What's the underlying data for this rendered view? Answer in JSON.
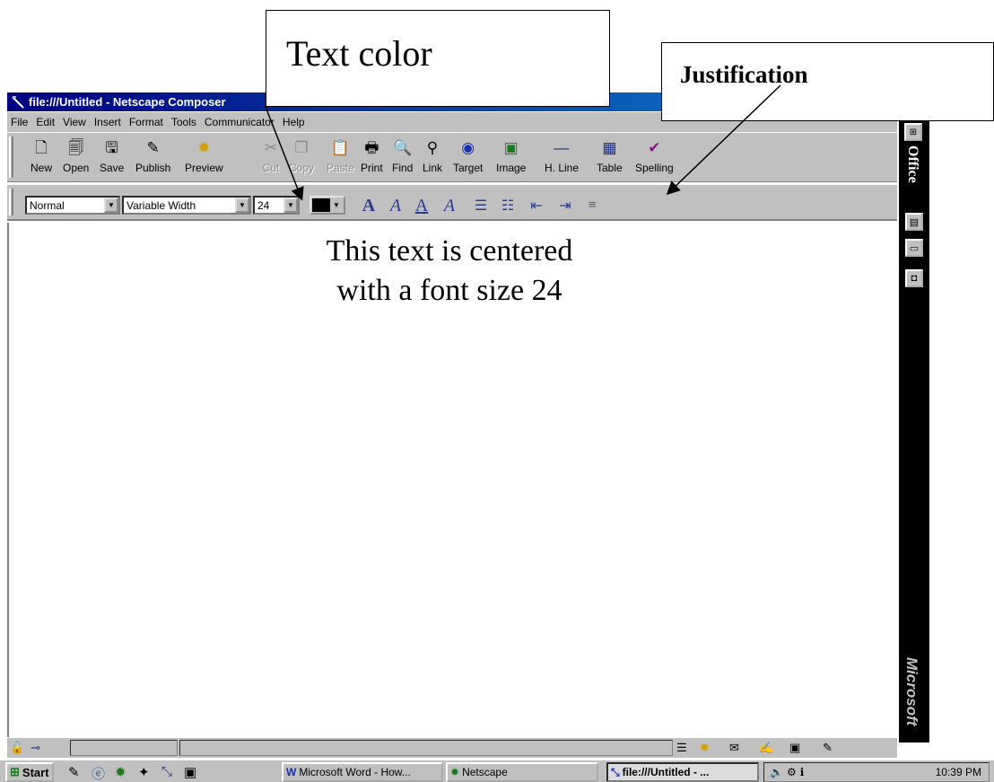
{
  "window": {
    "title": "file:///Untitled - Netscape Composer"
  },
  "menu": [
    "File",
    "Edit",
    "View",
    "Insert",
    "Format",
    "Tools",
    "Communicator",
    "Help"
  ],
  "toolbar": {
    "buttons": [
      {
        "label": "New",
        "icon": "new-page-icon"
      },
      {
        "label": "Open",
        "icon": "open-icon"
      },
      {
        "label": "Save",
        "icon": "save-disk-icon"
      },
      {
        "label": "Publish",
        "icon": "publish-icon"
      },
      {
        "label": "Preview",
        "icon": "preview-icon"
      },
      {
        "label": "Cut",
        "icon": "scissors-icon",
        "disabled": true
      },
      {
        "label": "Copy",
        "icon": "copy-icon",
        "disabled": true
      },
      {
        "label": "Paste",
        "icon": "paste-icon",
        "disabled": true
      },
      {
        "label": "Print",
        "icon": "printer-icon"
      },
      {
        "label": "Find",
        "icon": "find-icon"
      },
      {
        "label": "Link",
        "icon": "link-icon"
      },
      {
        "label": "Target",
        "icon": "target-icon"
      },
      {
        "label": "Image",
        "icon": "image-icon"
      },
      {
        "label": "H. Line",
        "icon": "horizontal-line-icon"
      },
      {
        "label": "Table",
        "icon": "table-icon"
      },
      {
        "label": "Spelling",
        "icon": "spelling-icon"
      }
    ]
  },
  "format": {
    "paragraph_style": "Normal",
    "font": "Variable Width",
    "font_size": "24",
    "text_color": "#000000"
  },
  "document": {
    "line1": "This text is centered",
    "line2": "with a font size 24"
  },
  "officebar": {
    "title": "Office",
    "brand": "Microsoft"
  },
  "taskbar": {
    "start": "Start",
    "tasks": [
      {
        "label": "Microsoft Word - How..."
      },
      {
        "label": "Netscape"
      },
      {
        "label": "file:///Untitled - ...",
        "active": true
      }
    ],
    "clock": "10:39 PM"
  },
  "callouts": {
    "text_color": "Text color",
    "justification": "Justification"
  }
}
